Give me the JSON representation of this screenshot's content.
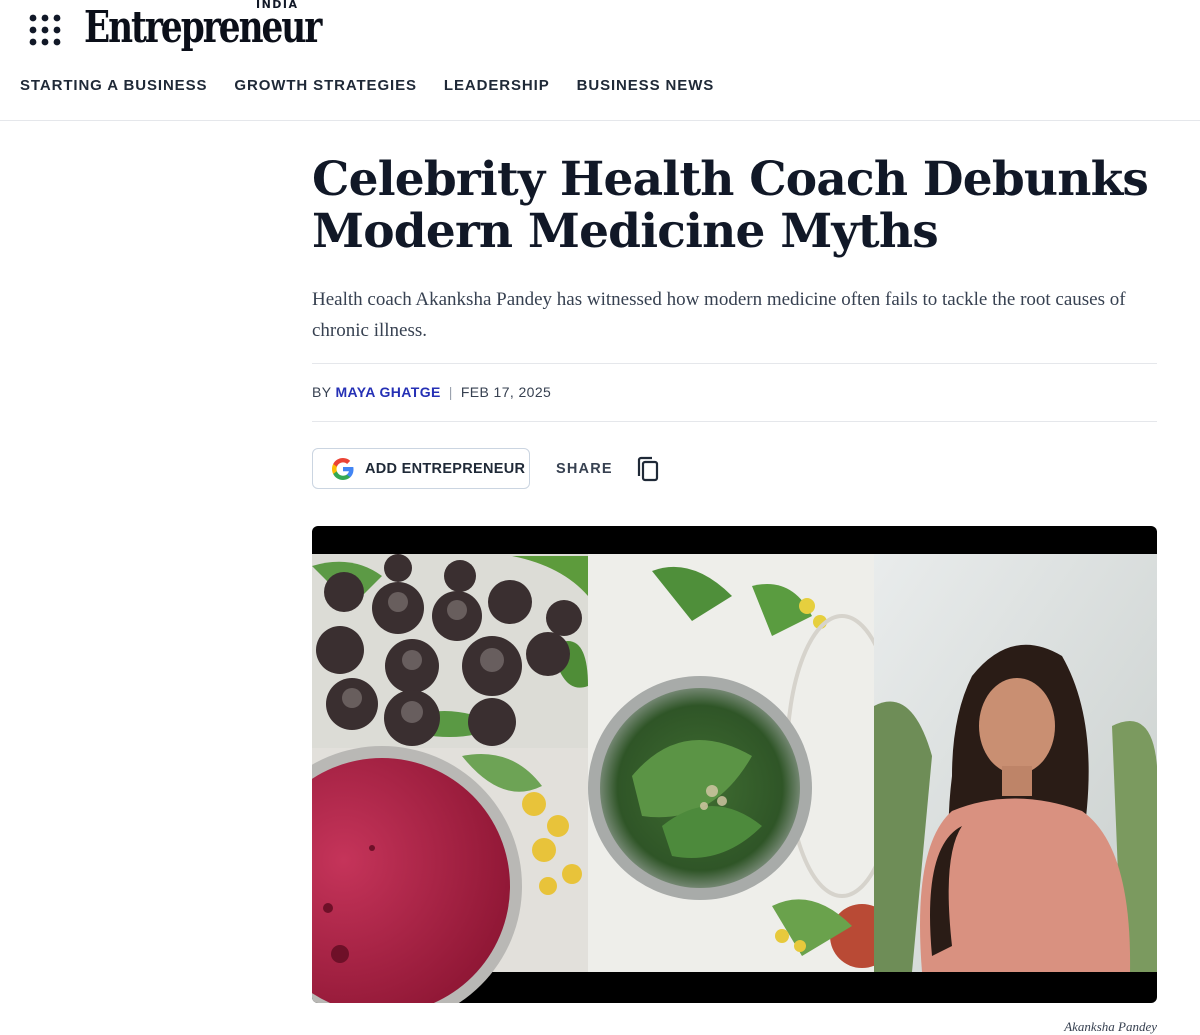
{
  "header": {
    "logo_edition": "INDIA",
    "logo_text": "Entrepreneur",
    "nav": [
      {
        "label": "STARTING A BUSINESS"
      },
      {
        "label": "GROWTH STRATEGIES"
      },
      {
        "label": "LEADERSHIP"
      },
      {
        "label": "BUSINESS NEWS"
      }
    ],
    "icons": {
      "menu": "grid-menu-icon"
    }
  },
  "article": {
    "headline": "Celebrity Health Coach Debunks Modern Medicine Myths",
    "dek": "Health coach Akanksha Pandey has witnessed how modern medicine often fails to tackle the root causes of chronic illness.",
    "byline_prefix": "BY",
    "author": "MAYA GHATGE",
    "separator": "|",
    "date": "FEB 17, 2025",
    "add_button_label": "ADD ENTREPRENEUR",
    "share_label": "SHARE",
    "image_caption": "Akanksha Pandey",
    "icons": {
      "add": "google-g-icon",
      "copy": "copy-link-icon"
    }
  },
  "colors": {
    "author_link": "#2530b5",
    "headline": "#111827",
    "rule": "#e5e7eb"
  }
}
